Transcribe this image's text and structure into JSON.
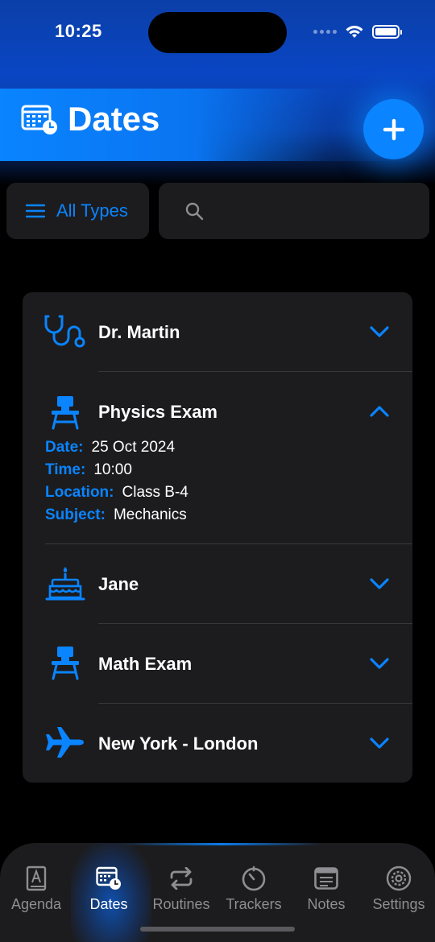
{
  "status_bar": {
    "time": "10:25"
  },
  "header": {
    "title": "Dates",
    "add_button_icon": "plus-icon"
  },
  "filter": {
    "label": "All Types",
    "icon": "list-icon"
  },
  "search": {
    "value": "",
    "placeholder": ""
  },
  "dates": [
    {
      "icon": "stethoscope-icon",
      "title": "Dr. Martin",
      "expanded": false
    },
    {
      "icon": "desk-icon",
      "title": "Physics Exam",
      "expanded": true,
      "details": [
        {
          "label": "Date:",
          "value": "25 Oct 2024"
        },
        {
          "label": "Time:",
          "value": "10:00"
        },
        {
          "label": "Location:",
          "value": "Class B-4"
        },
        {
          "label": "Subject:",
          "value": "Mechanics"
        }
      ]
    },
    {
      "icon": "birthday-cake-icon",
      "title": "Jane",
      "expanded": false
    },
    {
      "icon": "desk-icon",
      "title": "Math Exam",
      "expanded": false
    },
    {
      "icon": "airplane-icon",
      "title": "New York - London",
      "expanded": false
    }
  ],
  "tabbar": {
    "active": "Dates",
    "tabs": [
      {
        "label": "Agenda",
        "icon": "agenda-book-icon"
      },
      {
        "label": "Dates",
        "icon": "calendar-clock-icon"
      },
      {
        "label": "Routines",
        "icon": "repeat-icon"
      },
      {
        "label": "Trackers",
        "icon": "timer-icon"
      },
      {
        "label": "Notes",
        "icon": "notes-icon"
      },
      {
        "label": "Settings",
        "icon": "gear-icon"
      }
    ]
  },
  "colors": {
    "accent": "#0a84ff",
    "card": "#1c1c1e",
    "background": "#000000",
    "secondary_text": "#8e8e93"
  }
}
